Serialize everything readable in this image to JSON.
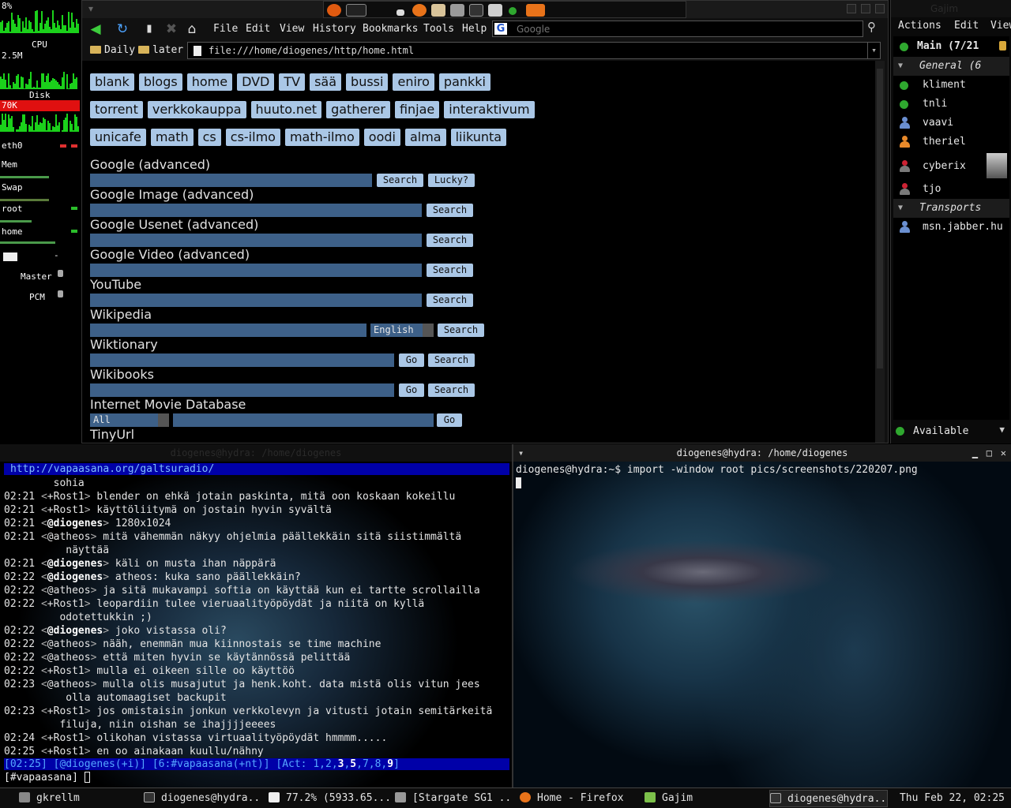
{
  "gkrellm": {
    "top_value": "8%",
    "cpu_label": "CPU",
    "proc_value": "2.5M",
    "disk_label": "Disk",
    "disk_value": "70K",
    "eth_label": "eth0",
    "mem_label": "Mem",
    "swap_label": "Swap",
    "root_label": "root",
    "home_label": "home",
    "mail_count": "-",
    "master_label": "Master",
    "pcm_label": "PCM"
  },
  "firefox": {
    "menu": [
      "File",
      "Edit",
      "View",
      "History",
      "Bookmarks",
      "Tools",
      "Help"
    ],
    "search_placeholder": "Google",
    "bookmarks": [
      "Daily",
      "later"
    ],
    "url": "file:///home/diogenes/http/home.html",
    "chips_row1": [
      "blank",
      "blogs",
      "home",
      "DVD",
      "TV",
      "sää",
      "bussi",
      "eniro",
      "pankki"
    ],
    "chips_row2": [
      "torrent",
      "verkkokauppa",
      "huuto.net",
      "gatherer",
      "finjae",
      "interaktivum"
    ],
    "chips_row3": [
      "unicafe",
      "math",
      "cs",
      "cs-ilmo",
      "math-ilmo",
      "oodi",
      "alma",
      "liikunta"
    ],
    "forms": {
      "google": "Google (advanced)",
      "google_image": "Google Image (advanced)",
      "google_usenet": "Google Usenet (advanced)",
      "google_video": "Google Video (advanced)",
      "youtube": "YouTube",
      "wikipedia": "Wikipedia",
      "wiktionary": "Wiktionary",
      "wikibooks": "Wikibooks",
      "imdb": "Internet Movie Database",
      "tinyurl": "TinyUrl"
    },
    "buttons": {
      "search": "Search",
      "lucky": "Lucky?",
      "go": "Go"
    },
    "wikipedia_lang": "English",
    "imdb_category": "All"
  },
  "gajim": {
    "title": "Gajim",
    "menu": [
      "Actions",
      "Edit",
      "View"
    ],
    "account": "Main (7/21",
    "group": "General (6",
    "contacts": [
      "kliment",
      "tnli",
      "vaavi",
      "theriel",
      "cyberix",
      "tjo"
    ],
    "transports_group": "Transports",
    "transport": "msn.jabber.hu",
    "status": "Available"
  },
  "irc": {
    "title": "diogenes@hydra: /home/diogenes",
    "topic": "http://vapaasana.org/galtsuradio/",
    "lines": [
      {
        "t": "",
        "n": "",
        "m": "        sohia"
      },
      {
        "t": "02:21",
        "n": "+Rost1",
        "m": "blender on ehkä jotain paskinta, mitä oon koskaan kokeillu"
      },
      {
        "t": "02:21",
        "n": "+Rost1",
        "m": "käyttöliitymä on jostain hyvin syvältä"
      },
      {
        "t": "02:21",
        "n": "@diogenes",
        "m": "1280x1024"
      },
      {
        "t": "02:21",
        "n": "@atheos",
        "m": "mitä vähemmän näkyy ohjelmia päällekkäin sitä siistimmältä"
      },
      {
        "t": "",
        "n": "",
        "m": "          näyttää"
      },
      {
        "t": "02:21",
        "n": "@diogenes",
        "m": "käli on musta ihan näppärä"
      },
      {
        "t": "02:22",
        "n": "@diogenes",
        "m": "atheos: kuka sano päällekkäin?"
      },
      {
        "t": "02:22",
        "n": "@atheos",
        "m": "ja sitä mukavampi softia on käyttää kun ei tartte scrollailla"
      },
      {
        "t": "02:22",
        "n": "+Rost1",
        "m": "leopardiin tulee vieruaalityöpöydät ja niitä on kyllä"
      },
      {
        "t": "",
        "n": "",
        "m": "         odotettukkin ;)"
      },
      {
        "t": "02:22",
        "n": "@diogenes",
        "m": "joko vistassa oli?"
      },
      {
        "t": "02:22",
        "n": "@atheos",
        "m": "nääh, enemmän mua kiinnostais se time machine"
      },
      {
        "t": "02:22",
        "n": "@atheos",
        "m": "että miten hyvin se käytännössä pelittää"
      },
      {
        "t": "02:22",
        "n": "+Rost1",
        "m": "mulla ei oikeen sille oo käyttöö"
      },
      {
        "t": "02:23",
        "n": "@atheos",
        "m": "mulla olis musajutut ja henk.koht. data mistä olis vitun jees"
      },
      {
        "t": "",
        "n": "",
        "m": "          olla automaagiset backupit"
      },
      {
        "t": "02:23",
        "n": "+Rost1",
        "m": "jos omistaisin jonkun verkkolevyn ja vitusti jotain semitärkeitä"
      },
      {
        "t": "",
        "n": "",
        "m": "         filuja, niin oishan se ihajjjjeeees"
      },
      {
        "t": "02:24",
        "n": "+Rost1",
        "m": "olikohan vistassa virtuaalityöpöydät hmmmm....."
      },
      {
        "t": "02:25",
        "n": "+Rost1",
        "m": "en oo ainakaan kuullu/nähny"
      }
    ],
    "status_line": "[02:25] [@diogenes(+i)] [6:#vapaasana(+nt)] [Act: 1,2,3,5,7,8,9]",
    "input_prompt": "[#vapaasana]"
  },
  "terminal": {
    "title": "diogenes@hydra: /home/diogenes",
    "command_line": "diogenes@hydra:~$ import -window root pics/screenshots/220207.png"
  },
  "taskbar": {
    "tasks": [
      "gkrellm",
      "diogenes@hydra...",
      "77.2% (5933.65...",
      "[Stargate SG1 ...",
      "Home - Firefox",
      "Gajim",
      "diogenes@hydra..."
    ],
    "clock": "Thu Feb 22, 02:25"
  },
  "colors": {
    "chip_bg": "#aac7e6",
    "input_bg": "#3d6088",
    "irc_bar": "#0000a8",
    "graph_green": "#1bd11b",
    "alert_red": "#e01010"
  }
}
